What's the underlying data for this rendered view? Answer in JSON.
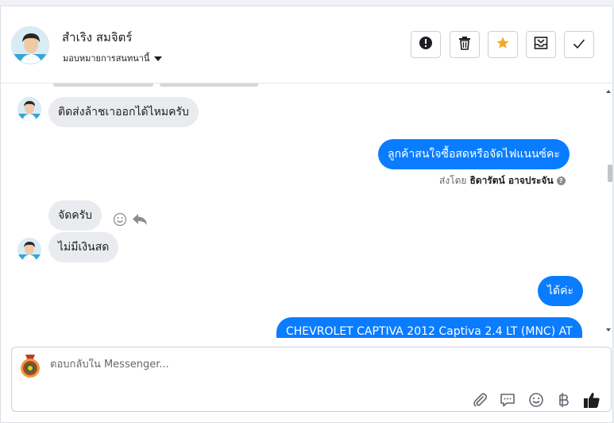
{
  "contact": {
    "name": "สำเริง สมจิตร์",
    "assign_label": "มอบหมายการสนทนานี้"
  },
  "header_actions": [
    {
      "icon": "exclamation-icon",
      "name": "report-button"
    },
    {
      "icon": "trash-icon",
      "name": "delete-button"
    },
    {
      "icon": "star-icon",
      "name": "star-button",
      "color": "#f5a623"
    },
    {
      "icon": "inbox-archive-icon",
      "name": "move-button"
    },
    {
      "icon": "checkmark-icon",
      "name": "done-button"
    }
  ],
  "messages": {
    "m1": "ติดส่งล้าชเาออกได้ไหมครับ",
    "m2": "ลูกค้าสนใจซื้อสดหรือจัดไฟแนนซ์คะ",
    "m2_sent_by_prefix": "ส่งโดย",
    "m2_sent_by_name": "ธิดารัตน์ อาจประจัน",
    "m3": "จัดครับ",
    "m4": "ไม่มีเงินสด",
    "m5": "ได้ค่ะ",
    "m6": "CHEVROLET CAPTIVA 2012 Captiva 2.4 LT (MNC) AT"
  },
  "composer": {
    "placeholder": "ตอบกลับใน Messenger...",
    "value": "",
    "tools": [
      "paperclip-icon",
      "saved-replies-icon",
      "emoji-icon",
      "baht-icon",
      "thumbs-up-icon"
    ]
  },
  "colors": {
    "accent": "#0a7cff",
    "star": "#f5a623",
    "incoming_bubble": "#e9ebee"
  }
}
